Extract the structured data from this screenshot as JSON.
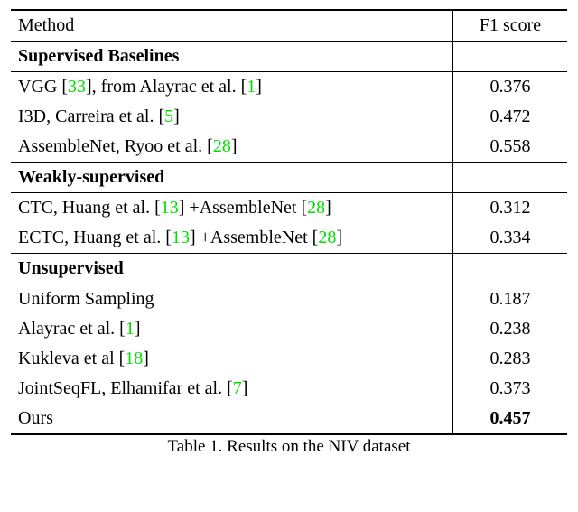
{
  "header": {
    "method": "Method",
    "score": "F1 score"
  },
  "sections": {
    "supervised": {
      "title": "Supervised Baselines",
      "rows": [
        {
          "m_pre": "VGG [",
          "c1": "33",
          "m_mid1": "], from Alayrac et al. [",
          "c2": "1",
          "m_post": "]",
          "score": "0.376"
        },
        {
          "m_pre": "I3D, Carreira et al. [",
          "c1": "5",
          "m_post": "]",
          "score": "0.472"
        },
        {
          "m_pre": "AssembleNet, Ryoo et al. [",
          "c1": "28",
          "m_post": "]",
          "score": "0.558"
        }
      ]
    },
    "weakly": {
      "title": "Weakly-supervised",
      "rows": [
        {
          "m_pre": "CTC, Huang et al. [",
          "c1": "13",
          "m_mid1": "] +AssembleNet [",
          "c2": "28",
          "m_post": "]",
          "score": "0.312"
        },
        {
          "m_pre": "ECTC, Huang et al. [",
          "c1": "13",
          "m_mid1": "] +AssembleNet [",
          "c2": "28",
          "m_post": "]",
          "score": "0.334"
        }
      ]
    },
    "unsupervised": {
      "title": "Unsupervised",
      "rows": [
        {
          "m_pre": "Uniform Sampling",
          "score": "0.187"
        },
        {
          "m_pre": "Alayrac et al. [",
          "c1": "1",
          "m_post": "]",
          "score": "0.238"
        },
        {
          "m_pre": "Kukleva et al [",
          "c1": "18",
          "m_post": "]",
          "score": "0.283"
        },
        {
          "m_pre": "JointSeqFL, Elhamifar et al. [",
          "c1": "7",
          "m_post": "]",
          "score": "0.373"
        },
        {
          "m_pre": "Ours",
          "score": "0.457",
          "bold": true
        }
      ]
    }
  },
  "caption": "Table 1. Results on the NIV dataset",
  "chart_data": {
    "type": "table",
    "title": "Table 1. Results on the NIV dataset",
    "columns": [
      "Method",
      "F1 score"
    ],
    "groups": [
      {
        "name": "Supervised Baselines",
        "rows": [
          {
            "Method": "VGG [33], from Alayrac et al. [1]",
            "F1 score": 0.376
          },
          {
            "Method": "I3D, Carreira et al. [5]",
            "F1 score": 0.472
          },
          {
            "Method": "AssembleNet, Ryoo et al. [28]",
            "F1 score": 0.558
          }
        ]
      },
      {
        "name": "Weakly-supervised",
        "rows": [
          {
            "Method": "CTC, Huang et al. [13] +AssembleNet [28]",
            "F1 score": 0.312
          },
          {
            "Method": "ECTC, Huang et al. [13] +AssembleNet [28]",
            "F1 score": 0.334
          }
        ]
      },
      {
        "name": "Unsupervised",
        "rows": [
          {
            "Method": "Uniform Sampling",
            "F1 score": 0.187
          },
          {
            "Method": "Alayrac et al. [1]",
            "F1 score": 0.238
          },
          {
            "Method": "Kukleva et al [18]",
            "F1 score": 0.283
          },
          {
            "Method": "JointSeqFL, Elhamifar et al. [7]",
            "F1 score": 0.373
          },
          {
            "Method": "Ours",
            "F1 score": 0.457
          }
        ]
      }
    ]
  }
}
